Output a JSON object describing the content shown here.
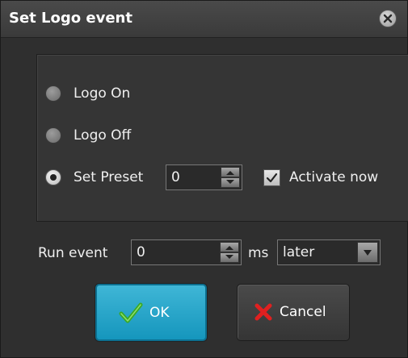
{
  "dialog": {
    "title": "Set Logo event"
  },
  "options": {
    "logo_on_label": "Logo On",
    "logo_off_label": "Logo Off",
    "set_preset_label": "Set Preset",
    "preset_value": "0",
    "activate_now_label": "Activate now",
    "selected": "set_preset",
    "activate_now_checked": true
  },
  "run_event": {
    "label": "Run event",
    "value": "0",
    "unit": "ms",
    "timing_selected": "later"
  },
  "buttons": {
    "ok_label": "OK",
    "cancel_label": "Cancel"
  },
  "icons": {
    "close": "close-icon",
    "ok": "checkmark-icon",
    "cancel": "red-x-icon"
  },
  "colors": {
    "background": "#2f2f2f",
    "ok_button": "#1fa3c9",
    "cancel_icon": "#e02020",
    "check_icon": "#3aa825"
  }
}
